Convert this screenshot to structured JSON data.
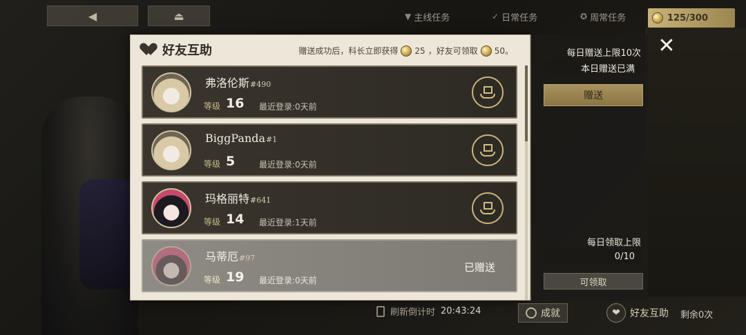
{
  "top_tabs": [
    {
      "label": "主线任务",
      "icon": "triangle-icon"
    },
    {
      "label": "日常任务",
      "icon": "check-circle-icon"
    },
    {
      "label": "周常任务",
      "icon": "star-circle-icon"
    }
  ],
  "quest_counter": "125/300",
  "modal": {
    "title": "好友互助",
    "reward_note_prefix": "赠送成功后，科长立即获得",
    "reward_self": "25",
    "reward_note_mid": "，好友可领取",
    "reward_friend": "50。"
  },
  "friends": [
    {
      "name": "弗洛伦斯",
      "tag": "#490",
      "level_label": "等级",
      "level": "16",
      "login": "最近登录:0天前",
      "status": "gift"
    },
    {
      "name": "BiggPanda",
      "tag": "#1",
      "level_label": "等级",
      "level": "5",
      "login": "最近登录:0天前",
      "status": "gift"
    },
    {
      "name": "玛格丽特",
      "tag": "#641",
      "level_label": "等级",
      "level": "14",
      "login": "最近登录:1天前",
      "status": "gift"
    },
    {
      "name": "马蒂厄",
      "tag": "#97",
      "level_label": "等级",
      "level": "19",
      "login": "最近登录:0天前",
      "status": "given",
      "status_text": "已赠送"
    }
  ],
  "side": {
    "daily_send_limit": "每日赠送上限10次",
    "daily_send_status": "本日赠送已满",
    "send_button": "赠送",
    "daily_claim_limit": "每日领取上限",
    "claim_count": "0/10",
    "claim_button": "可领取"
  },
  "bottom": {
    "refresh_label": "刷新倒计时",
    "refresh_time": "20:43:24",
    "achievement": "成就",
    "friend_help": "好友互助",
    "remaining": "剩余0次"
  }
}
